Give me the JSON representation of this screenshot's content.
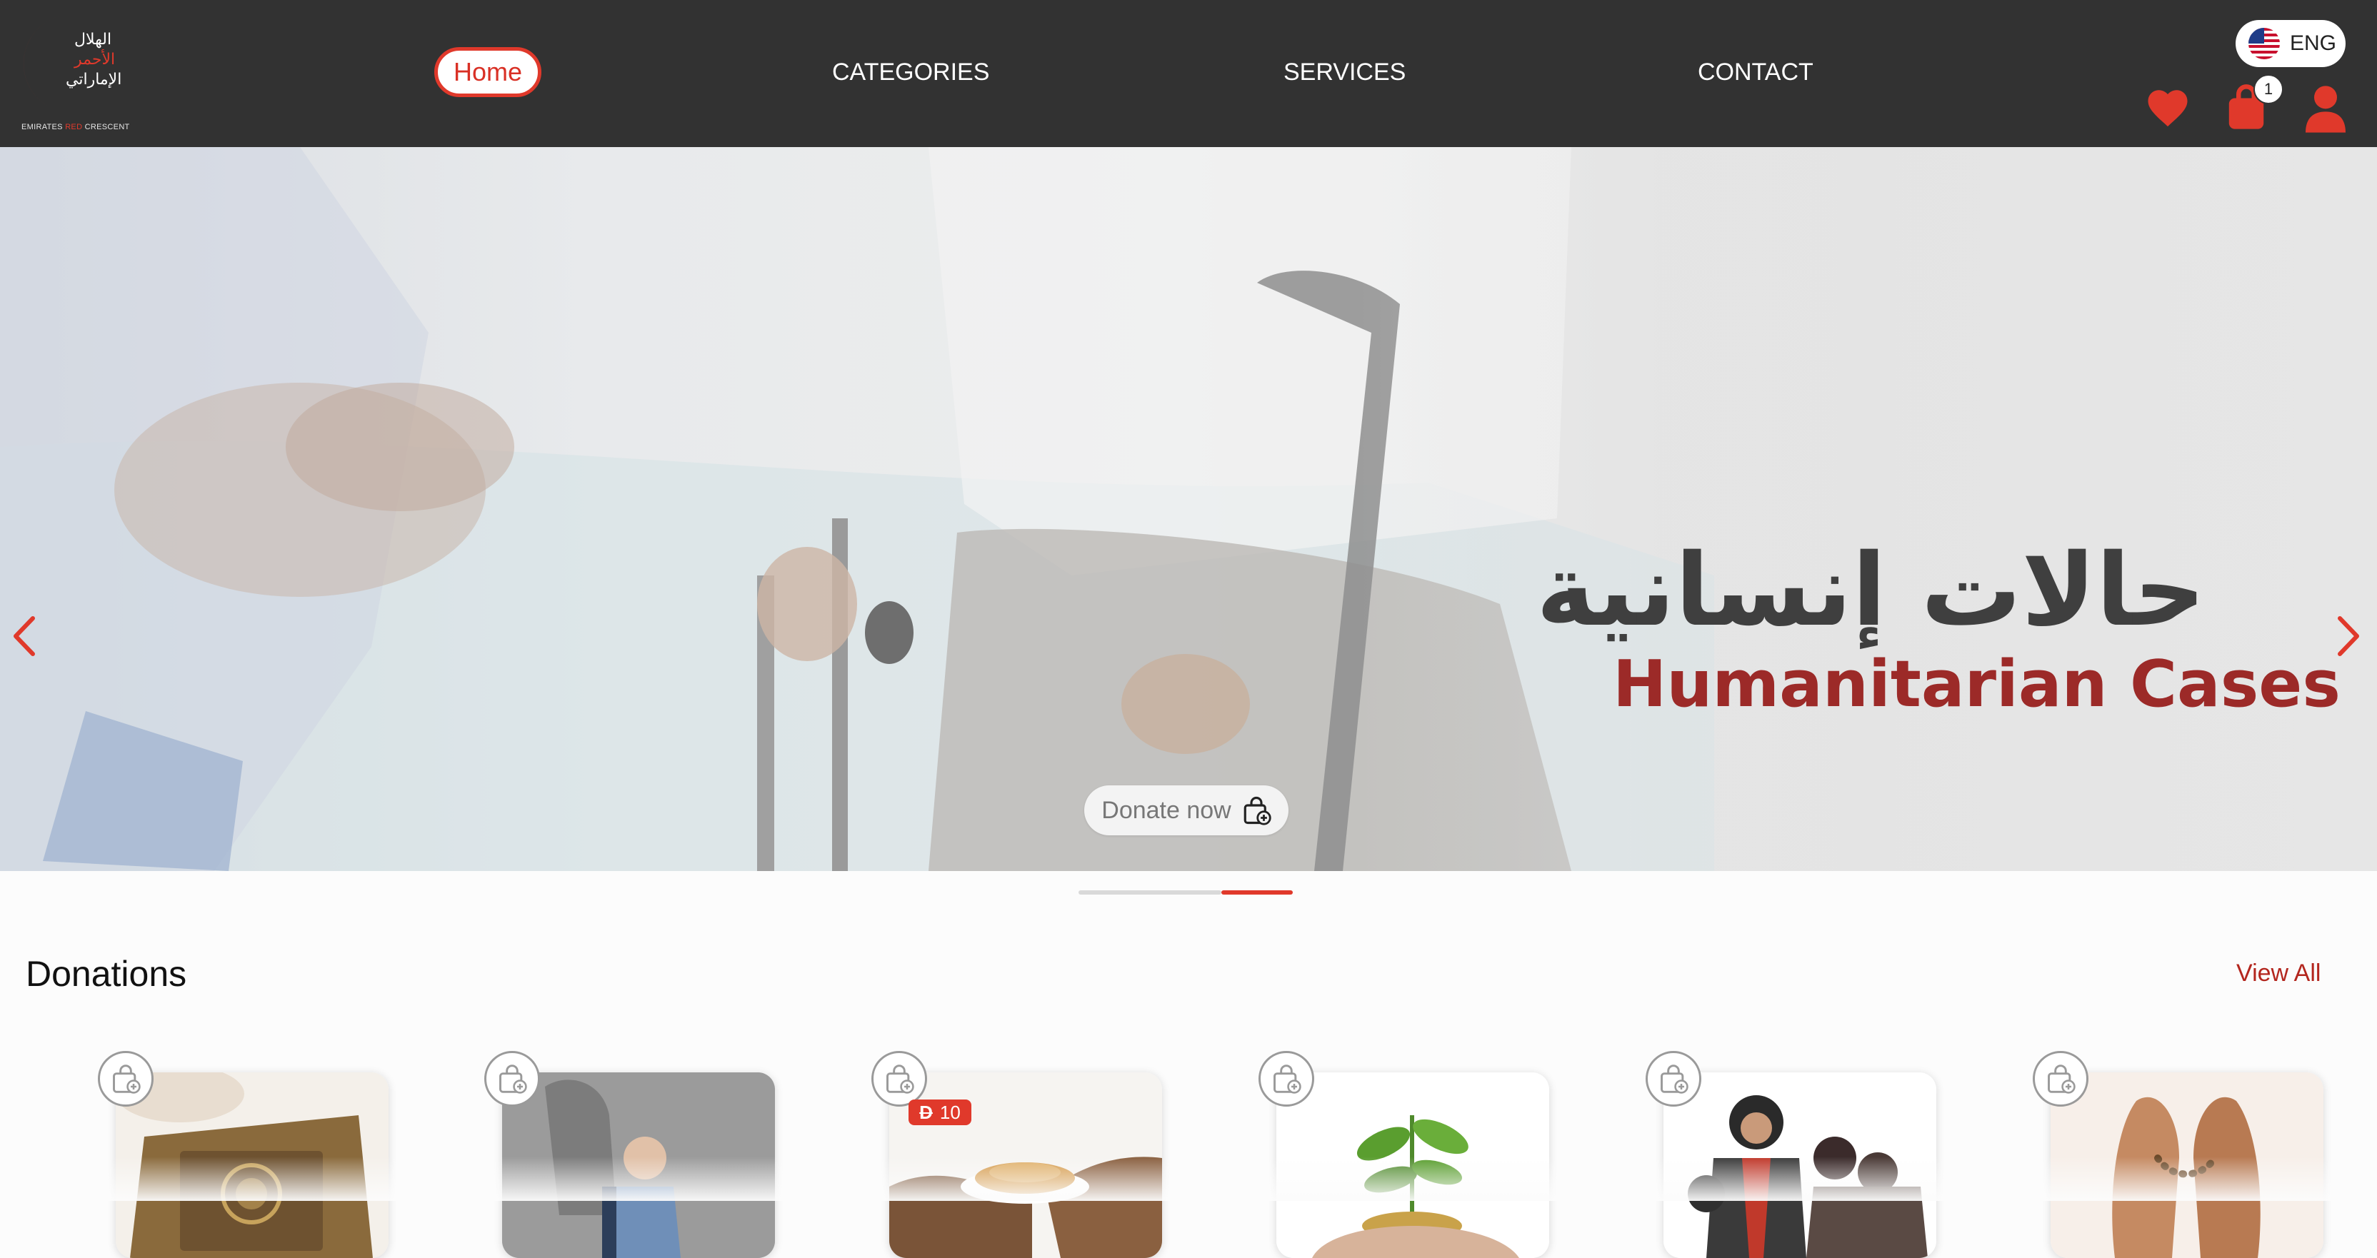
{
  "logo": {
    "arabic_line1": "الهلال",
    "arabic_line2": "الأحمر",
    "arabic_line3": "الإماراتي",
    "sub_emirates": "EMIRATES",
    "sub_red": "RED",
    "sub_crescent": "CRESCENT"
  },
  "nav": {
    "home": "Home",
    "categories": "CATEGORIES",
    "services": "SERVICES",
    "contact": "CONTACT"
  },
  "language": {
    "label": "ENG",
    "flag_icon": "us-flag-icon"
  },
  "cart": {
    "count": "1"
  },
  "hero": {
    "title_ar": "حالات إنسانية",
    "title_en": "Humanitarian Cases",
    "donate_label": "Donate now"
  },
  "slider": {
    "total": 3,
    "active": 3
  },
  "donations": {
    "title": "Donations",
    "view_all": "View All",
    "price_badge": {
      "currency": "D",
      "amount": "10"
    },
    "cards": [
      {
        "name": "quran-reading"
      },
      {
        "name": "child-education"
      },
      {
        "name": "food-sharing"
      },
      {
        "name": "sapling-coins"
      },
      {
        "name": "family-relief"
      },
      {
        "name": "prayer-hands"
      }
    ]
  },
  "colors": {
    "nav_bg": "#323232",
    "accent_red": "#e0392b",
    "title_red": "#9c2a28"
  }
}
